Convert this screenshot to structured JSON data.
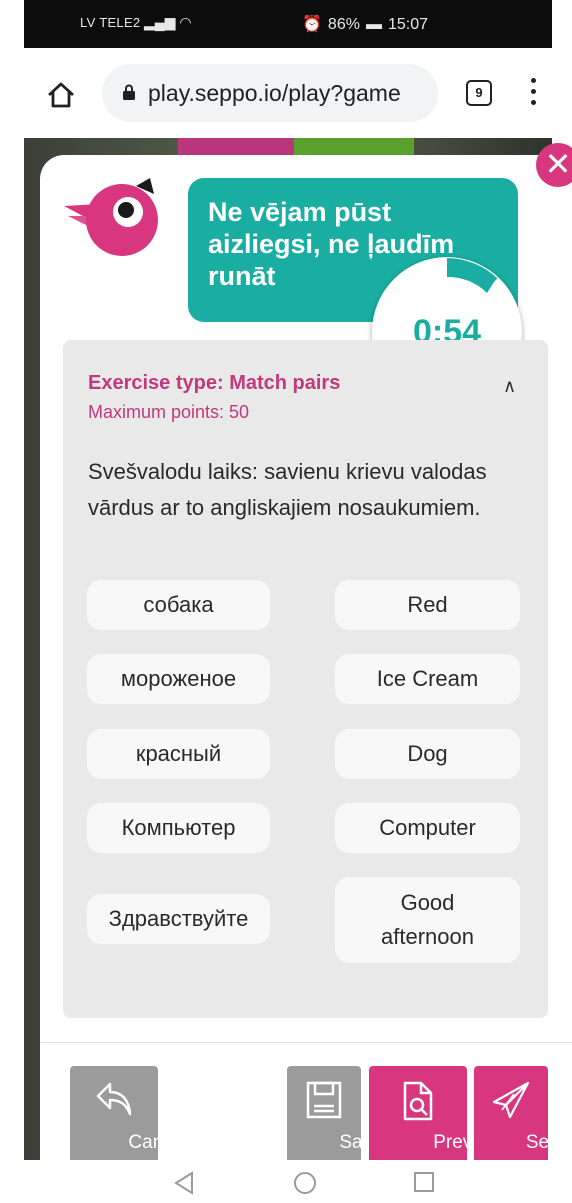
{
  "status_bar": {
    "carrier": "LV TELE2",
    "battery": "86%",
    "time": "15:07"
  },
  "browser": {
    "url": "play.seppo.io/play?game",
    "tab_count": "9"
  },
  "task": {
    "title": "Ne vējam pūst aizliegsi, ne ļaudīm runāt",
    "timer": "0:54",
    "exercise_type": "Exercise type: Match pairs",
    "max_points": "Maximum points: 50",
    "instructions": "Svešvalodu laiks: savienu krievu valodas vārdus ar to angliskajiem nosaukumiem.",
    "pairs": [
      {
        "left": "собака",
        "right": "Red"
      },
      {
        "left": "мороженое",
        "right": "Ice Cream"
      },
      {
        "left": "красный",
        "right": "Dog"
      },
      {
        "left": "Компьютер",
        "right": "Computer"
      },
      {
        "left": "Здравствуйте",
        "right": "Good afternoon"
      }
    ]
  },
  "actions": {
    "cancel": "Cancel",
    "save": "Save",
    "preview": "Preview",
    "send": "Send"
  },
  "colors": {
    "brand_pink": "#d8377f",
    "teal": "#1aaea3",
    "gray_button": "#9b9b9b"
  }
}
